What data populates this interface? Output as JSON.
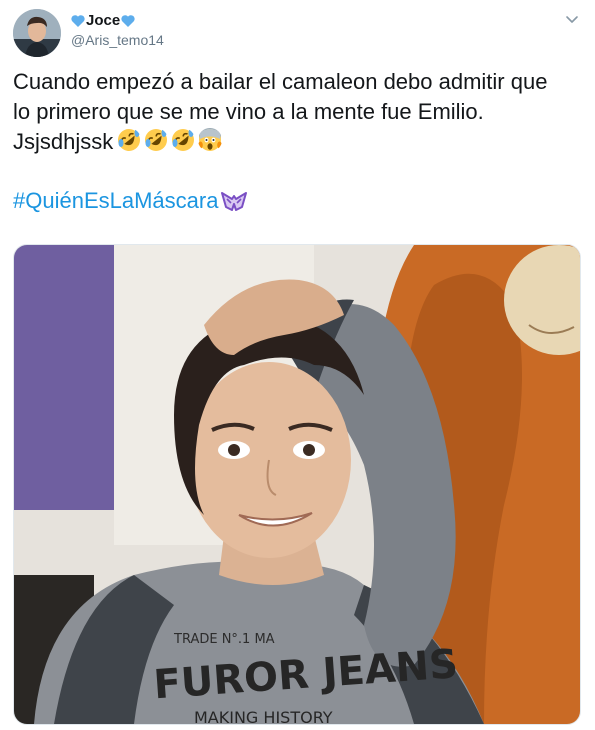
{
  "user": {
    "name": "Joce",
    "handle": "@Aris_temo14",
    "avatar_icon": "profile-photo-avatar",
    "name_emoji": "blue-heart-icon",
    "heart_color": "#5dadec"
  },
  "tweet": {
    "lines": [
      "Cuando empezó a bailar el camaleon debo admitir que",
      "lo primero que se me vino a la mente fue Emilio.",
      "Jsjsdhjssk"
    ],
    "emojis": [
      "rolling-on-floor-laughing-icon",
      "rolling-on-floor-laughing-icon",
      "rolling-on-floor-laughing-icon",
      "screaming-in-fear-icon"
    ],
    "hashtag": "#QuiénEsLaMáscara",
    "hashtag_icon": "purple-mask-icon",
    "link_color": "#1b95e0"
  },
  "media": {
    "shirt_text_top": "TRADE  N°.1  MA",
    "shirt_text_main": "FUROR JEANS",
    "shirt_text_bottom": "MAKING HISTORY"
  }
}
